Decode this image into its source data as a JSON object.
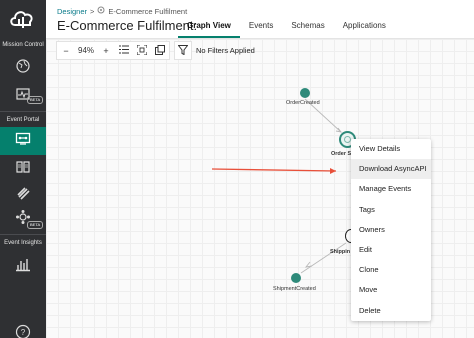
{
  "sidebar": {
    "sections": [
      {
        "label": "Mission Control"
      },
      {
        "label": "Event Portal"
      },
      {
        "label": "Event Insights"
      }
    ],
    "items": [
      {
        "icon": "globe-icon",
        "badge": ""
      },
      {
        "icon": "pulse-chart-icon",
        "badge": "BETA"
      },
      {
        "icon": "designer-icon",
        "badge": ""
      },
      {
        "icon": "catalog-book-icon",
        "badge": ""
      },
      {
        "icon": "runtime-tag-icon",
        "badge": ""
      },
      {
        "icon": "kpi-network-icon",
        "badge": "BETA"
      },
      {
        "icon": "bar-chart-icon",
        "badge": ""
      },
      {
        "icon": "help-icon",
        "badge": ""
      }
    ]
  },
  "breadcrumb": {
    "root": "Designer",
    "separator": ">",
    "current": "E-Commerce Fulfilment"
  },
  "page": {
    "title": "E-Commerce Fulfilment:"
  },
  "tabs": [
    {
      "label": "Graph View",
      "active": true
    },
    {
      "label": "Events",
      "active": false
    },
    {
      "label": "Schemas",
      "active": false
    },
    {
      "label": "Applications",
      "active": false
    }
  ],
  "toolbar": {
    "zoom_out": "−",
    "zoom_level": "94%",
    "zoom_in": "+",
    "filter_status": "No Filters Applied"
  },
  "graph": {
    "nodes": [
      {
        "label": "OrderCreated"
      },
      {
        "label": "Order S"
      },
      {
        "label": "Shippin"
      },
      {
        "label": "ShipmentCreated"
      }
    ]
  },
  "context_menu": {
    "items": [
      {
        "label": "View Details"
      },
      {
        "label": "Download AsyncAPI",
        "highlighted": true
      },
      {
        "label": "Manage Events"
      },
      {
        "label": "Tags"
      },
      {
        "label": "Owners"
      },
      {
        "label": "Edit"
      },
      {
        "label": "Clone"
      },
      {
        "label": "Move"
      },
      {
        "label": "Delete"
      }
    ]
  },
  "colors": {
    "sidebar_bg": "#2f3033",
    "accent": "#05806d",
    "annotation_arrow": "#e8503a",
    "link": "#0a7b8a"
  }
}
